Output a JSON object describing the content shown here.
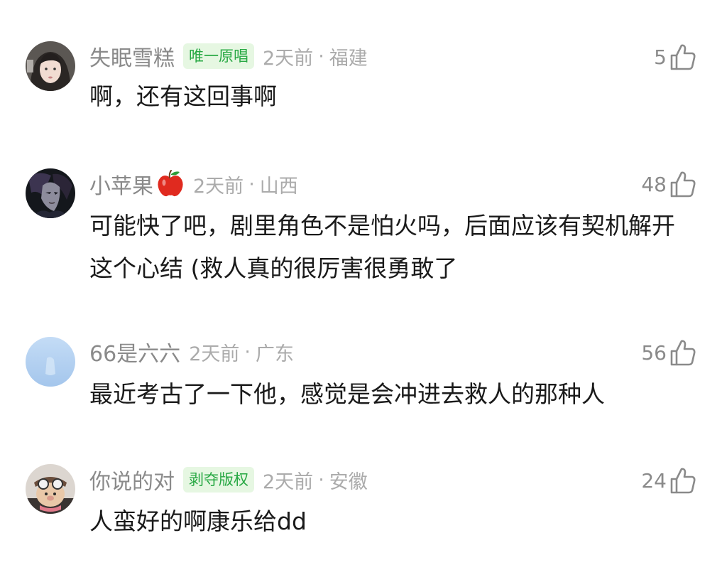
{
  "comments": [
    {
      "username": "失眠雪糕",
      "badge": "唯一原唱",
      "time": "2天前",
      "separator": "·",
      "location": "福建",
      "likes": "5",
      "text": "啊，还有这回事啊",
      "avatar": "avatar-girl"
    },
    {
      "username": "小苹果",
      "emoji": "apple-emoji",
      "time": "2天前",
      "separator": "·",
      "location": "山西",
      "likes": "48",
      "text": "可能快了吧，剧里角色不是怕火吗，后面应该有契机解开这个心结 (救人真的很厉害很勇敢了",
      "avatar": "avatar-dark-character"
    },
    {
      "username": "66是六六",
      "time": "2天前",
      "separator": "·",
      "location": "广东",
      "likes": "56",
      "text": "最近考古了一下他，感觉是会冲进去救人的那种人",
      "avatar": "avatar-light-blue"
    },
    {
      "username": "你说的对",
      "badge": "剥夺版权",
      "time": "2天前",
      "separator": "·",
      "location": "安徽",
      "likes": "24",
      "text": "人蛮好的啊康乐给dd",
      "avatar": "avatar-toy"
    }
  ],
  "colors": {
    "username": "#8a8a8a",
    "meta": "#ababab",
    "body": "#1a1a1a",
    "badge_bg": "#e6f7e2",
    "badge_text": "#27a843"
  },
  "icons": {
    "like": "thumbs-up-outline-icon"
  }
}
